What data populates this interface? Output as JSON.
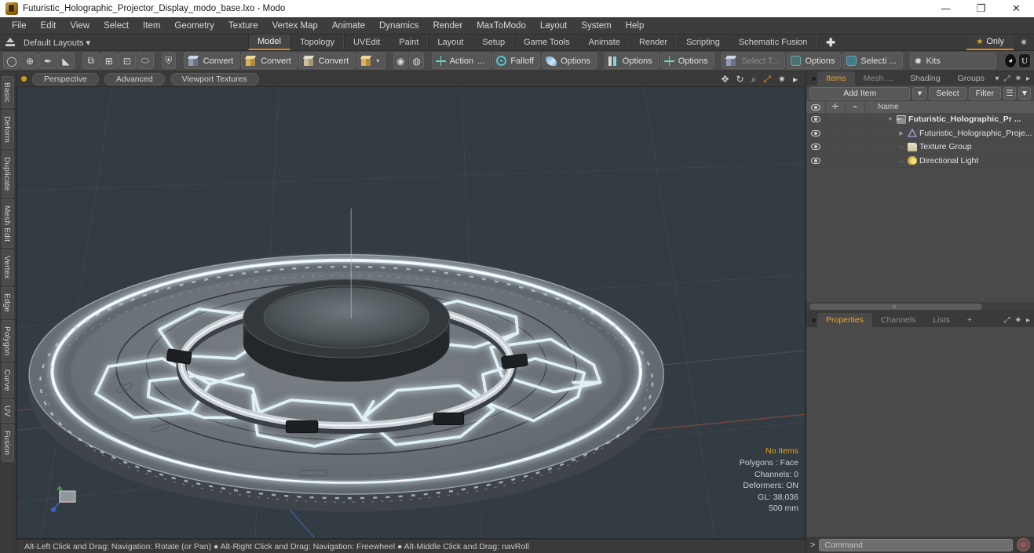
{
  "titlebar": {
    "title": "Futuristic_Holographic_Projector_Display_modo_base.lxo - Modo",
    "icon": "modo-app-icon",
    "minimize": "—",
    "maximize": "❐",
    "close": "✕"
  },
  "menubar": {
    "items": [
      {
        "label": "File"
      },
      {
        "label": "Edit"
      },
      {
        "label": "View"
      },
      {
        "label": "Select"
      },
      {
        "label": "Item"
      },
      {
        "label": "Geometry"
      },
      {
        "label": "Texture"
      },
      {
        "label": "Vertex Map"
      },
      {
        "label": "Animate"
      },
      {
        "label": "Dynamics"
      },
      {
        "label": "Render"
      },
      {
        "label": "MaxToModo"
      },
      {
        "label": "Layout"
      },
      {
        "label": "System"
      },
      {
        "label": "Help"
      }
    ]
  },
  "layoutbar": {
    "home_icon": "home-icon",
    "default_layouts": "Default Layouts ▾",
    "tabs": [
      {
        "label": "Model",
        "active": true
      },
      {
        "label": "Topology",
        "active": false
      },
      {
        "label": "UVEdit",
        "active": false
      },
      {
        "label": "Paint",
        "active": false
      },
      {
        "label": "Layout",
        "active": false
      },
      {
        "label": "Setup",
        "active": false
      },
      {
        "label": "Game Tools",
        "active": false
      },
      {
        "label": "Animate",
        "active": false
      },
      {
        "label": "Render",
        "active": false
      },
      {
        "label": "Scripting",
        "active": false
      },
      {
        "label": "Schematic Fusion",
        "active": false
      }
    ],
    "add_tab": "✚",
    "only_label": "Only",
    "only_star": "★",
    "settings_icon": "gear-icon"
  },
  "toolbar": {
    "shape_icons": [
      {
        "name": "circle-icon",
        "glyph": "◯"
      },
      {
        "name": "globe-icon",
        "glyph": "⊕"
      },
      {
        "name": "pen-icon",
        "glyph": "✒"
      },
      {
        "name": "sculpt-icon",
        "glyph": "◣"
      }
    ],
    "mesh_icons": [
      {
        "name": "mesh-ops-icon",
        "glyph": "⧉"
      },
      {
        "name": "array-icon",
        "glyph": "⊞"
      },
      {
        "name": "frame-icon",
        "glyph": "⊡"
      },
      {
        "name": "ellipse-icon",
        "glyph": "⬭"
      }
    ],
    "shield_icon": "shield-icon",
    "convert_buttons": [
      {
        "label": "Convert",
        "icon": "cube-blue-icon"
      },
      {
        "label": "Convert",
        "icon": "cube-gold-icon"
      },
      {
        "label": "Convert",
        "icon": "cube-tan-icon"
      }
    ],
    "convert_dropdown": {
      "icon": "cube-gold-icon",
      "caret": "▾"
    },
    "sphere_icons": [
      {
        "name": "material-sphere-icon"
      },
      {
        "name": "material-sphere-alt-icon"
      }
    ],
    "action_button": {
      "label": "Action",
      "suffix": "...",
      "icon": "action-center-icon"
    },
    "falloff_button": {
      "label": "Falloff",
      "icon": "falloff-icon"
    },
    "options_swoop": {
      "label": "Options",
      "icon": "swoop-icon"
    },
    "options_bars": {
      "label": "Options",
      "icon": "bars-icon"
    },
    "options_cross": {
      "label": "Options",
      "icon": "cross-icon"
    },
    "select_through": {
      "label": "Select T...",
      "icon": "select-through-icon"
    },
    "options_select": {
      "label": "Options",
      "icon": "lasso-icon"
    },
    "selection_set": {
      "label": "Selecti ...",
      "icon": "selection-icon"
    },
    "kits_button": {
      "label": "Kits",
      "icon": "kits-gear-icon"
    },
    "round_badge": {
      "name": "unreal-sphere-icon",
      "glyph": "◕"
    },
    "u_badge": {
      "name": "unity-icon",
      "glyph": "U"
    }
  },
  "vertical_tabs": [
    {
      "label": "Basic"
    },
    {
      "label": "Deform"
    },
    {
      "label": "Duplicate"
    },
    {
      "label": "Mesh Edit"
    },
    {
      "label": "Vertex"
    },
    {
      "label": "Edge"
    },
    {
      "label": "Polygon"
    },
    {
      "label": "Curve"
    },
    {
      "label": "UV"
    },
    {
      "label": "Fusion"
    }
  ],
  "viewport": {
    "indicator_dot": "active-viewport-dot",
    "pills": [
      {
        "label": "Perspective"
      },
      {
        "label": "Advanced"
      },
      {
        "label": "Viewport Textures"
      }
    ],
    "tools": [
      {
        "name": "pan-icon",
        "glyph": "✥"
      },
      {
        "name": "rotate-icon",
        "glyph": "↻"
      },
      {
        "name": "zoom-icon",
        "glyph": "⌕"
      },
      {
        "name": "fit-icon",
        "glyph": "⤢",
        "gold": true
      },
      {
        "name": "viewport-settings-icon",
        "glyph": "✷"
      },
      {
        "name": "more-icon",
        "glyph": "▸"
      }
    ],
    "stats": {
      "selection": "No Items",
      "polygons": "Polygons : Face",
      "channels": "Channels: 0",
      "deformers": "Deformers: ON",
      "gl": "GL: 38,036",
      "scale": "500 mm"
    },
    "background_color": "#333c42",
    "model_name": "futuristic holographic projector disc platform with glowing hexagonal emitter pattern"
  },
  "statusbar": {
    "text": "Alt-Left Click and Drag: Navigation: Rotate (or Pan)  ●  Alt-Right Click and Drag: Navigation: Freewheel  ●  Alt-Middle Click and Drag: navRoll"
  },
  "right_panel": {
    "tabs": [
      {
        "label": "Items",
        "active": true
      },
      {
        "label": "Mesh ...",
        "active": false
      },
      {
        "label": "Shading",
        "active": false
      },
      {
        "label": "Groups",
        "active": false
      }
    ],
    "tab_controls": [
      {
        "name": "dropdown-caret-icon",
        "glyph": "▾"
      },
      {
        "name": "expand-icon",
        "glyph": "⤢"
      },
      {
        "name": "gear-icon",
        "glyph": "✷"
      },
      {
        "name": "more-icon",
        "glyph": "▸"
      }
    ],
    "toolrow": {
      "add_item": "Add Item",
      "add_item_caret": "▾",
      "select": "Select",
      "filter": "Filter",
      "filter_list_icon": "filter-list-icon",
      "filter_funnel_icon": "filter-funnel-icon"
    },
    "list_headers": {
      "eye": "visibility-column",
      "lock": "lock-column",
      "texture": "texture-column",
      "name": "Name"
    },
    "items": [
      {
        "label": "Futuristic_Holographic_Pr ...",
        "icon": "mesh-icon",
        "depth": 0,
        "twisty": "▼",
        "bold": true
      },
      {
        "label": "Futuristic_Holographic_Proje...",
        "icon": "object-icon",
        "depth": 1,
        "twisty": "▶",
        "bold": false
      },
      {
        "label": "Texture Group",
        "icon": "folder-icon",
        "depth": 1,
        "twisty": "–",
        "bold": false
      },
      {
        "label": "Directional Light",
        "icon": "light-icon",
        "depth": 1,
        "twisty": "–",
        "bold": false
      }
    ],
    "properties_tabs": [
      {
        "label": "Properties",
        "active": true
      },
      {
        "label": "Channels",
        "active": false
      },
      {
        "label": "Lists",
        "active": false
      },
      {
        "label": "+",
        "active": false
      }
    ],
    "properties_controls": [
      {
        "name": "expand-icon",
        "glyph": "⤢"
      },
      {
        "name": "gear-icon",
        "glyph": "✷"
      },
      {
        "name": "more-icon",
        "glyph": "▸"
      }
    ]
  },
  "command_bar": {
    "prompt": ">",
    "placeholder": "Command",
    "record_icon": "record-macro-icon"
  }
}
